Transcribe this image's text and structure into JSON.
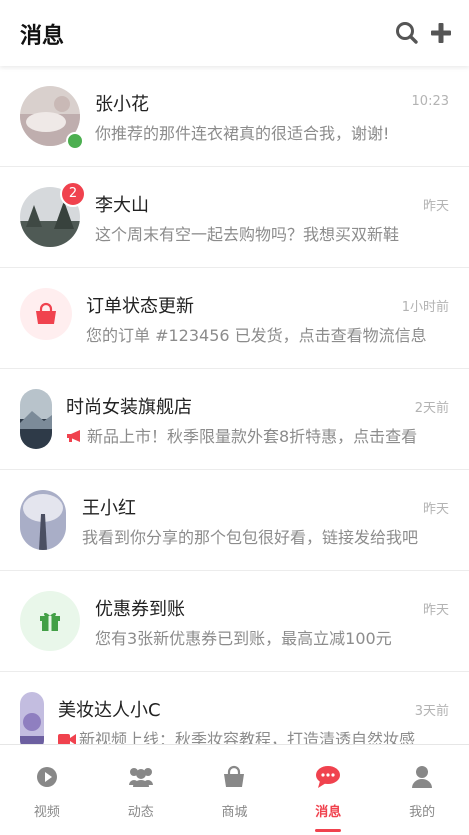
{
  "header": {
    "title": "消息"
  },
  "messages": [
    {
      "name": "张小花",
      "time": "10:23",
      "preview": "你推荐的那件连衣裙真的很适合我，谢谢!"
    },
    {
      "name": "李大山",
      "time": "昨天",
      "preview": "这个周末有空一起去购物吗？我想买双新鞋",
      "badge": "2"
    },
    {
      "name": "订单状态更新",
      "time": "1小时前",
      "preview": "您的订单 #123456 已发货，点击查看物流信息"
    },
    {
      "name": "时尚女装旗舰店",
      "time": "2天前",
      "preview": "新品上市！秋季限量款外套8折特惠，点击查看"
    },
    {
      "name": "王小红",
      "time": "昨天",
      "preview": "我看到你分享的那个包包很好看，链接发给我吧"
    },
    {
      "name": "优惠券到账",
      "time": "昨天",
      "preview": "您有3张新优惠券已到账，最高立减100元"
    },
    {
      "name": "美妆达人小C",
      "time": "3天前",
      "preview": "新视频上线：秋季妆容教程，打造清透自然妆感"
    }
  ],
  "tabs": [
    {
      "label": "视频",
      "icon": "play-icon"
    },
    {
      "label": "动态",
      "icon": "users-icon"
    },
    {
      "label": "商城",
      "icon": "shopping-bag-icon"
    },
    {
      "label": "消息",
      "icon": "chat-icon",
      "active": true
    },
    {
      "label": "我的",
      "icon": "user-icon"
    }
  ],
  "colors": {
    "accent": "#f0424e",
    "online": "#4caf50",
    "coupon_green": "#43a047"
  }
}
